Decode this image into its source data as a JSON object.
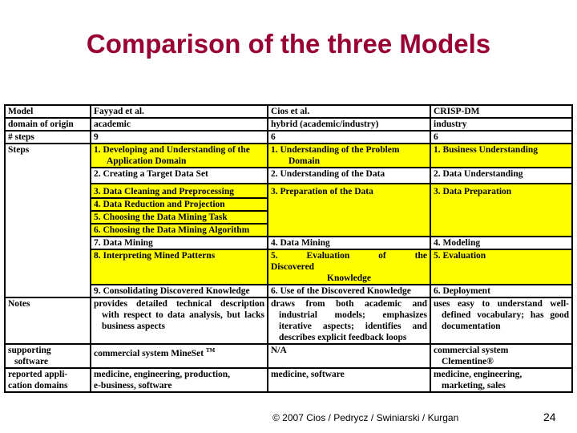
{
  "title": "Comparison of the three Models",
  "table": {
    "row_labels": {
      "model": "Model",
      "domain": "domain of origin",
      "steps_count": "# steps",
      "steps": "Steps",
      "notes": "Notes",
      "software_1": "supporting",
      "software_2": "software",
      "app_domains_1": "reported appli-",
      "app_domains_2": "cation domains"
    },
    "models": [
      {
        "name": "Fayyad et al.",
        "domain": "academic",
        "steps_count": "9",
        "steps": [
          {
            "text_1": "1. Developing and Understanding of the",
            "text_2": "Application Domain",
            "highlight": true
          },
          {
            "text_1": "2. Creating a Target Data Set",
            "highlight": false
          },
          {
            "text_1": "3. Data Cleaning and Preprocessing",
            "highlight": true
          },
          {
            "text_1": "4. Data Reduction and Projection",
            "highlight": true
          },
          {
            "text_1": "5. Choosing the Data Mining Task",
            "highlight": true
          },
          {
            "text_1": "6. Choosing the Data Mining Algorithm",
            "highlight": true
          },
          {
            "text_1": "7. Data Mining",
            "highlight": false
          },
          {
            "text_1": "8. Interpreting Mined Patterns",
            "highlight": true
          },
          {
            "text_1": "9. Consolidating Discovered Knowledge",
            "highlight": false
          }
        ],
        "notes": "provides detailed technical description with respect to data analysis, but lacks business aspects",
        "software": "commercial system MineSet",
        "software_mark": "TM",
        "app_domains_1": "medicine, engineering, production,",
        "app_domains_2": "e-business, software"
      },
      {
        "name": "Cios et al.",
        "domain": "hybrid (academic/industry)",
        "steps_count": "6",
        "steps": [
          {
            "text_1": "1. Understanding of the Problem",
            "text_2": "Domain",
            "highlight": true
          },
          {
            "text_1": "2. Understanding of the Data",
            "highlight": false
          },
          {
            "text_1": "3. Preparation of the Data",
            "highlight": true
          },
          {
            "text_1": "4. Data Mining",
            "highlight": false
          },
          {
            "text_1": "5. Evaluation of the Discovered",
            "text_2": "Knowledge",
            "highlight": true
          },
          {
            "text_1": "6. Use of the Discovered Knowledge",
            "highlight": false
          }
        ],
        "notes": "draws from both academic and industrial models; emphasizes iterative aspects; identifies and describes explicit feedback loops",
        "software": "N/A",
        "app_domains_1": "medicine, software"
      },
      {
        "name": "CRISP-DM",
        "domain": "industry",
        "steps_count": "6",
        "steps": [
          {
            "text_1": "1. Business Understanding",
            "highlight": true
          },
          {
            "text_1": "2. Data Understanding",
            "highlight": false
          },
          {
            "text_1": "3. Data Preparation",
            "highlight": true
          },
          {
            "text_1": "4. Modeling",
            "highlight": false
          },
          {
            "text_1": "5. Evaluation",
            "highlight": true
          },
          {
            "text_1": "6. Deployment",
            "highlight": false
          }
        ],
        "notes": "uses easy to understand well-defined vocabulary; has good documentation",
        "software_1": "commercial system",
        "software_2": "Clementine®",
        "app_domains_1": "medicine, engineering,",
        "app_domains_2": "marketing, sales"
      }
    ]
  },
  "colors": {
    "title": "#990033",
    "highlight": "#ffff00"
  },
  "footer": {
    "copyright": "© 2007 Cios / Pedrycz / Swiniarski / Kurgan",
    "page_number": "24"
  }
}
